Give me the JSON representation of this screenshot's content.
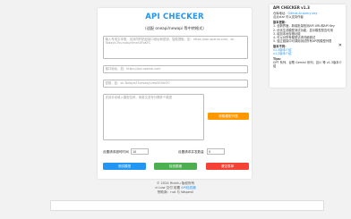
{
  "main": {
    "title": "API CHECKER",
    "subtitle": "（适配 oneapi/newapi 等中转格式）",
    "multi_placeholder": "输入专用文本框，支持同时粘贴接口地址和密钥，智能提取，如：https://api.openai.com，sk-TodayIsThursdayVme50FoKFC",
    "url_placeholder": "接口地址，如：https://api.openai.com",
    "key_placeholder": "密钥，如：sk-TodayIsThursdayVme50FoKFC",
    "model_placeholder": "支持手动填入模型名称，用英文逗号分隔多个模型",
    "fetch_models_label": "获取模型列表",
    "timeout_label": "设置请求超时时间",
    "timeout_value": "10",
    "concurrency_label": "设置请求并发数量",
    "concurrency_value": "5",
    "test_button": "测试模型",
    "check_quota_button": "检查额度",
    "clear_button": "清空表单"
  },
  "footer": {
    "copyright": "© 2024 Rickliu 版权所有",
    "line2_prefix": "ci.Low 交付 前置 ",
    "line2_link": "API检查器",
    "line3": "赞助商：rud 与 Wapevil"
  },
  "panel": {
    "title": "API CHECKER v1.3",
    "github_prefix": "仓库地址：",
    "github_link": "Github-Ai-query-key",
    "support": "点点star 可以支持作者",
    "update_heading": "版本更新：",
    "updates": [
      "1. 全新界面，新增批量检测API URL和API Key",
      "2. 优化生成模型测试功能，显示模型是否可用",
      "3. 增加本地存储功能",
      "4. 可以对所有模型请求详细调试",
      "5. 独立链接中可调用测试所有API的模型列表"
    ],
    "versions_heading": "版本不同：",
    "versions": [
      "v1.3版本介绍",
      "v1.2版本介绍"
    ],
    "tips_heading": "Tips：",
    "tips": "GPT 系列、谷歌 Gemini 系列、百川 等 v1.3版本介绍"
  }
}
